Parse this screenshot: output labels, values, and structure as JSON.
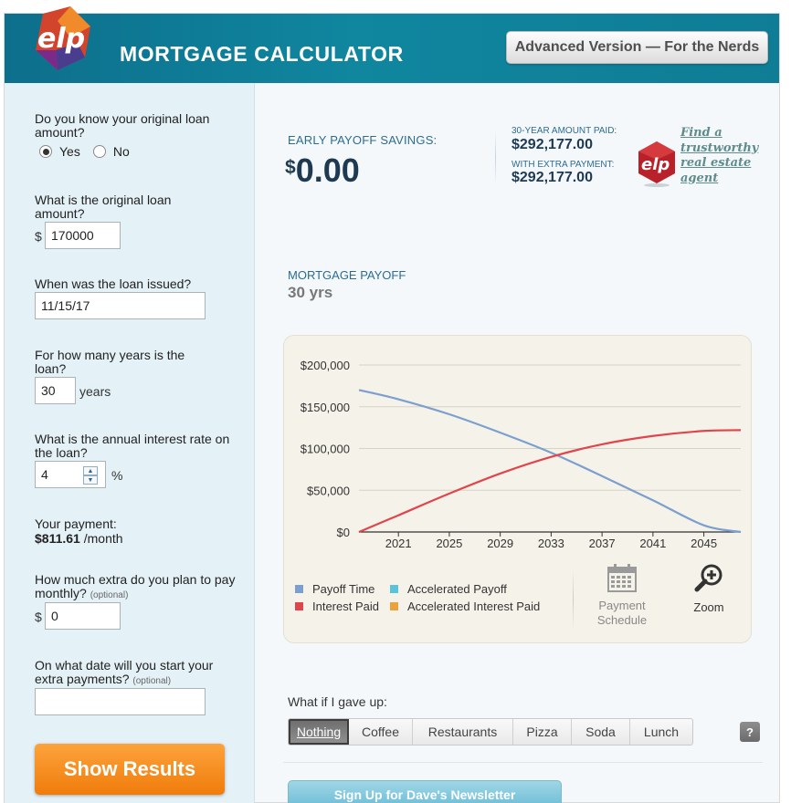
{
  "header": {
    "logo_text": "elp",
    "title": "MORTGAGE CALCULATOR",
    "advanced_button": "Advanced Version — For the Nerds"
  },
  "form": {
    "q_know_loan": "Do you know your original loan amount?",
    "radio_yes": "Yes",
    "radio_no": "No",
    "radio_selected": "Yes",
    "q_loan_amount": "What is the original loan amount?",
    "currency_symbol": "$",
    "loan_amount_value": "170000",
    "q_issued": "When was the loan issued?",
    "issued_value": "11/15/17",
    "q_years": "For how many years is the loan?",
    "years_value": "30",
    "years_unit": "years",
    "q_rate": "What is the annual interest rate on the loan?",
    "rate_value": "4",
    "rate_unit": "%",
    "payment_label": "Your payment:",
    "payment_value": "$811.61",
    "payment_unit": "/month",
    "q_extra": "How much extra do you plan to pay monthly?",
    "optional_tag": "(optional)",
    "extra_value": "0",
    "q_start_date": "On what date will you start your extra payments?",
    "start_date_value": "",
    "show_results": "Show Results"
  },
  "summary": {
    "early_payoff_label": "EARLY PAYOFF SAVINGS:",
    "early_payoff_currency": "$",
    "early_payoff_value": "0.00",
    "thirty_year_label": "30-YEAR AMOUNT PAID:",
    "thirty_year_value": "$292,177.00",
    "extra_label": "WITH EXTRA PAYMENT:",
    "extra_value": "$292,177.00",
    "agent_badge_text": "elp",
    "agent_link": "Find a trustworthy real estate agent"
  },
  "payoff": {
    "label": "MORTGAGE PAYOFF",
    "value": "30 yrs"
  },
  "chart_data": {
    "type": "line",
    "y_tick_labels": [
      "$200,000",
      "$150,000",
      "$100,000",
      "$50,000",
      "$0"
    ],
    "x_tick_labels": [
      "2021",
      "2025",
      "2029",
      "2033",
      "2037",
      "2041",
      "2045"
    ],
    "ylim": [
      0,
      200000
    ],
    "xlim": [
      2017.9,
      2047.9
    ],
    "grid": true,
    "legend_position": "bottom",
    "series": [
      {
        "name": "Payoff Time",
        "color": "#7b9fce",
        "x": [
          2017.9,
          2021,
          2025,
          2029,
          2033,
          2037,
          2041,
          2045,
          2047.9
        ],
        "values": [
          170000,
          159000,
          141000,
          119000,
          95000,
          67000,
          38000,
          8000,
          0
        ]
      },
      {
        "name": "Interest Paid",
        "color": "#e0454c",
        "x": [
          2017.9,
          2021,
          2025,
          2029,
          2033,
          2037,
          2041,
          2045,
          2047.9
        ],
        "values": [
          0,
          20000,
          46000,
          70000,
          90000,
          105000,
          115000,
          121000,
          122000
        ]
      }
    ],
    "legend": [
      {
        "name": "Payoff Time",
        "color": "#7b9fce"
      },
      {
        "name": "Accelerated Payoff",
        "color": "#5cc2d9"
      },
      {
        "name": "Interest Paid",
        "color": "#e0454c"
      },
      {
        "name": "Accelerated Interest Paid",
        "color": "#e9a33a"
      }
    ]
  },
  "chart_tools": {
    "schedule_label": "Payment Schedule",
    "zoom_label": "Zoom"
  },
  "giveup": {
    "label": "What if I gave up:",
    "options": [
      "Nothing",
      "Coffee",
      "Restaurants",
      "Pizza",
      "Soda",
      "Lunch"
    ],
    "selected": "Nothing",
    "help": "?"
  },
  "newsletter_button": "Sign Up for Dave's Newsletter"
}
